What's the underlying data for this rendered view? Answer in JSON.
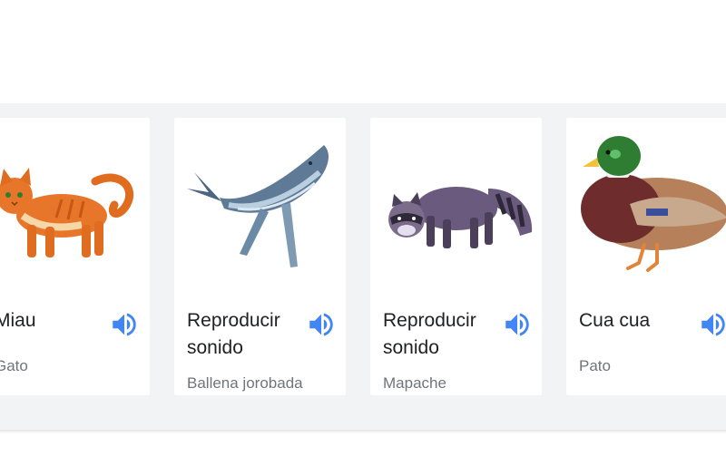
{
  "cards": [
    {
      "title": "Miau",
      "subtitle": "Gato",
      "icon": "volume-icon"
    },
    {
      "title": "Reproducir sonido",
      "subtitle": "Ballena jorobada",
      "icon": "volume-icon"
    },
    {
      "title": "Reproducir sonido",
      "subtitle": "Mapache",
      "icon": "volume-icon"
    },
    {
      "title": "Cua cua",
      "subtitle": "Pato",
      "icon": "volume-icon"
    }
  ],
  "colors": {
    "speaker": "#4285f4",
    "background": "#f1f3f4"
  }
}
